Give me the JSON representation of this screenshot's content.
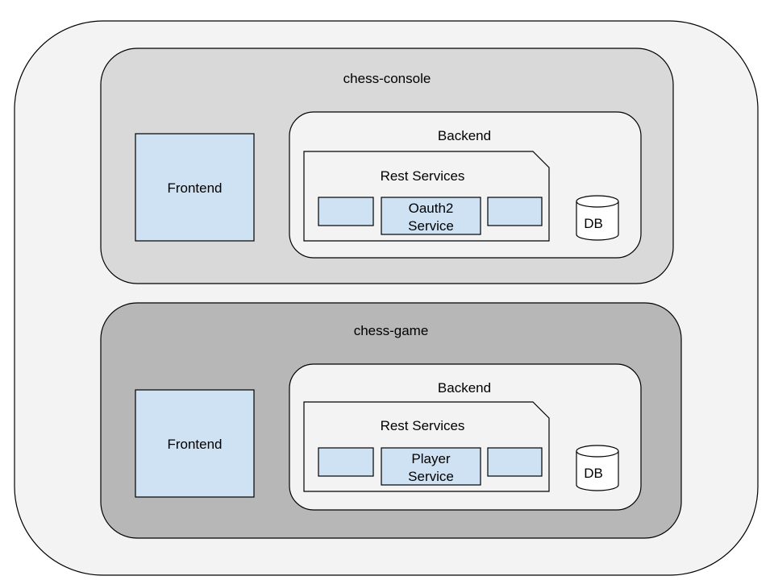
{
  "colors": {
    "outer": "#f3f3f3",
    "console": "#d9d9d9",
    "game": "#b7b7b7",
    "backend": "#f3f3f3",
    "component": "#cfe2f3"
  },
  "console": {
    "title": "chess-console",
    "frontend": "Frontend",
    "backend": "Backend",
    "rest": "Rest Services",
    "service_line1": "Oauth2",
    "service_line2": "Service",
    "db": "DB"
  },
  "game": {
    "title": "chess-game",
    "frontend": "Frontend",
    "backend": "Backend",
    "rest": "Rest Services",
    "service_line1": "Player",
    "service_line2": "Service",
    "db": "DB"
  }
}
